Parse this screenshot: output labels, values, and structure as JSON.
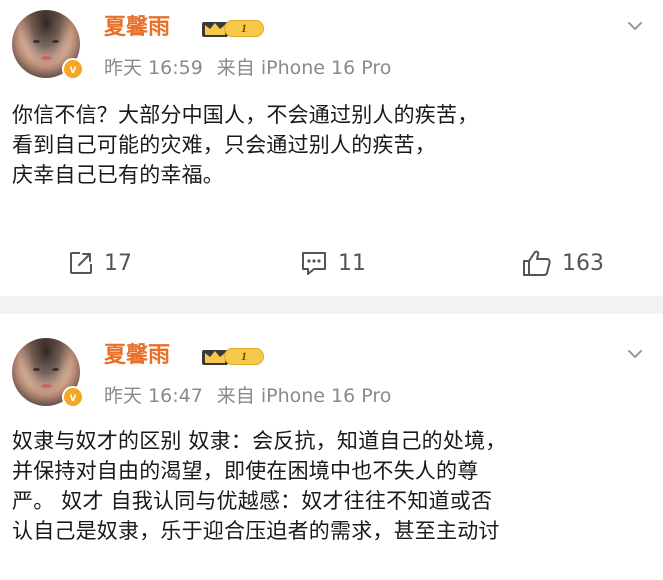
{
  "posts": [
    {
      "username": "夏馨雨",
      "level_badge": "1",
      "verified_mark": "v",
      "time": "昨天 16:59",
      "source": "来自 iPhone 16 Pro",
      "content_lines": [
        "你信不信？大部分中国人，不会通过别人的疾苦，",
        "看到自己可能的灾难，只会通过别人的疾苦，",
        "庆幸自己已有的幸福。"
      ],
      "actions": {
        "repost_count": "17",
        "comment_count": "11",
        "like_count": "163"
      },
      "icons": {
        "repost": "share-icon",
        "comment": "comment-icon",
        "like": "thumbs-up-icon",
        "menu": "chevron-down-icon"
      }
    },
    {
      "username": "夏馨雨",
      "level_badge": "1",
      "verified_mark": "v",
      "time": "昨天 16:47",
      "source": "来自 iPhone 16 Pro",
      "content_lines": [
        "奴隶与奴才的区别 奴隶：会反抗，知道自己的处境，",
        "并保持对自由的渴望，即使在困境中也不失人的尊",
        "严。 奴才 自我认同与优越感：奴才往往不知道或否",
        "认自己是奴隶，乐于迎合压迫者的需求，甚至主动讨"
      ]
    }
  ],
  "colors": {
    "username": "#e8702a",
    "meta": "#8a8a8a",
    "badge_gold": "#f6c94a",
    "verified": "#f5a623",
    "separator": "#f2f2f2"
  }
}
